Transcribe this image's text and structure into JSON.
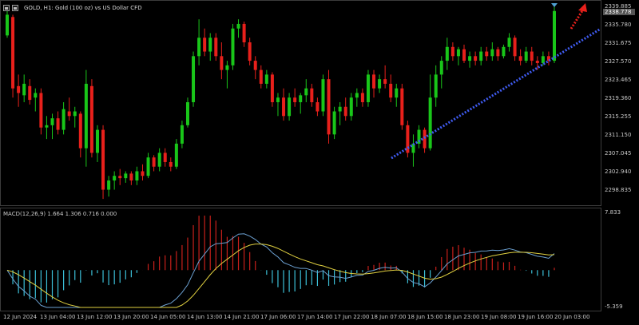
{
  "window": {
    "title": "GOLD, H1:  Gold (100 oz) vs US Dollar CFD"
  },
  "colors": {
    "background": "#000000",
    "bull_candle": "#19c619",
    "bear_candle": "#e8201b",
    "trendline": "#3f5bf0",
    "projection_arrow": "#e8201b",
    "macd_line": "#6b9fd0",
    "signal_line": "#e0d040",
    "hist_positive": "#c8201b",
    "hist_negative": "#3cc0d8",
    "marker": "#4fa0d0"
  },
  "price_axis": {
    "labels": [
      "2339.885",
      "2335.780",
      "2331.675",
      "2327.570",
      "2323.465",
      "2319.360",
      "2315.255",
      "2311.150",
      "2307.045",
      "2302.940",
      "2298.835"
    ],
    "current_price": "2338.778"
  },
  "macd": {
    "title": "MACD(12,26,9) 1.664 1.306 0.716 0.000",
    "axis_top": "7.833",
    "axis_bottom": "-5.359"
  },
  "time_axis": {
    "labels": [
      "12 Jun 2024",
      "13 Jun 04:00",
      "13 Jun 12:00",
      "13 Jun 20:00",
      "14 Jun 05:00",
      "14 Jun 13:00",
      "14 Jun 21:00",
      "17 Jun 06:00",
      "17 Jun 14:00",
      "17 Jun 22:00",
      "18 Jun 07:00",
      "18 Jun 15:00",
      "18 Jun 23:00",
      "19 Jun 08:00",
      "19 Jun 16:00",
      "20 Jun 03:00"
    ]
  },
  "chart_data": {
    "type": "candlestick",
    "symbol": "GOLD",
    "timeframe": "H1",
    "ylim": [
      2296.8,
      2340.5
    ],
    "candles": [
      [
        2333.5,
        2340.0,
        2333.0,
        2338.0
      ],
      [
        2337.5,
        2338.0,
        2320.0,
        2322.0
      ],
      [
        2322.5,
        2325.0,
        2318.0,
        2321.0
      ],
      [
        2320.5,
        2325.0,
        2319.0,
        2323.0
      ],
      [
        2322.5,
        2324.0,
        2318.5,
        2319.5
      ],
      [
        2320.0,
        2322.0,
        2317.0,
        2321.0
      ],
      [
        2321.0,
        2322.0,
        2312.0,
        2313.5
      ],
      [
        2313.5,
        2316.0,
        2311.0,
        2314.0
      ],
      [
        2314.0,
        2316.5,
        2311.0,
        2315.5
      ],
      [
        2315.5,
        2317.0,
        2312.0,
        2313.0
      ],
      [
        2313.0,
        2319.0,
        2312.0,
        2317.5
      ],
      [
        2317.0,
        2320.0,
        2315.0,
        2316.0
      ],
      [
        2316.0,
        2318.0,
        2313.5,
        2317.0
      ],
      [
        2316.5,
        2317.0,
        2307.0,
        2309.0
      ],
      [
        2309.0,
        2326.0,
        2305.0,
        2323.0
      ],
      [
        2322.5,
        2324.0,
        2307.0,
        2308.0
      ],
      [
        2308.0,
        2314.0,
        2306.0,
        2313.0
      ],
      [
        2313.0,
        2314.0,
        2298.0,
        2300.0
      ],
      [
        2300.0,
        2303.0,
        2298.5,
        2302.0
      ],
      [
        2302.0,
        2304.0,
        2300.0,
        2303.0
      ],
      [
        2303.0,
        2304.5,
        2301.0,
        2302.5
      ],
      [
        2302.5,
        2304.0,
        2301.5,
        2303.5
      ],
      [
        2303.5,
        2304.0,
        2301.0,
        2302.0
      ],
      [
        2302.0,
        2305.0,
        2301.0,
        2304.0
      ],
      [
        2304.0,
        2305.5,
        2302.0,
        2303.0
      ],
      [
        2303.0,
        2308.0,
        2302.5,
        2307.0
      ],
      [
        2307.0,
        2307.5,
        2304.0,
        2305.0
      ],
      [
        2305.0,
        2309.0,
        2304.0,
        2308.0
      ],
      [
        2308.0,
        2309.0,
        2305.0,
        2306.0
      ],
      [
        2306.0,
        2307.0,
        2304.0,
        2305.0
      ],
      [
        2305.0,
        2311.0,
        2304.5,
        2310.0
      ],
      [
        2310.0,
        2315.0,
        2309.0,
        2314.0
      ],
      [
        2314.0,
        2320.0,
        2313.5,
        2319.0
      ],
      [
        2319.0,
        2330.0,
        2318.0,
        2329.0
      ],
      [
        2329.0,
        2337.0,
        2327.0,
        2333.0
      ],
      [
        2333.0,
        2335.0,
        2329.0,
        2330.0
      ],
      [
        2330.0,
        2334.0,
        2328.0,
        2333.0
      ],
      [
        2333.0,
        2334.0,
        2328.0,
        2329.0
      ],
      [
        2329.0,
        2332.0,
        2324.0,
        2326.0
      ],
      [
        2326.0,
        2328.0,
        2322.0,
        2327.0
      ],
      [
        2327.0,
        2336.0,
        2326.0,
        2335.0
      ],
      [
        2335.0,
        2337.0,
        2333.0,
        2336.0
      ],
      [
        2336.0,
        2336.5,
        2331.0,
        2332.0
      ],
      [
        2332.0,
        2333.0,
        2327.0,
        2328.0
      ],
      [
        2328.0,
        2329.0,
        2324.0,
        2326.0
      ],
      [
        2326.0,
        2327.0,
        2322.0,
        2323.0
      ],
      [
        2323.0,
        2326.0,
        2322.0,
        2325.0
      ],
      [
        2325.0,
        2325.5,
        2318.0,
        2319.0
      ],
      [
        2319.0,
        2321.0,
        2316.0,
        2320.0
      ],
      [
        2320.0,
        2322.0,
        2315.0,
        2316.0
      ],
      [
        2316.0,
        2321.0,
        2315.0,
        2320.0
      ],
      [
        2320.0,
        2322.0,
        2318.0,
        2319.0
      ],
      [
        2319.0,
        2321.0,
        2316.5,
        2320.5
      ],
      [
        2320.5,
        2324.0,
        2319.0,
        2322.0
      ],
      [
        2322.0,
        2323.0,
        2318.0,
        2319.0
      ],
      [
        2319.0,
        2320.0,
        2316.0,
        2317.0
      ],
      [
        2317.0,
        2325.0,
        2316.0,
        2324.0
      ],
      [
        2324.0,
        2326.0,
        2310.0,
        2312.0
      ],
      [
        2312.0,
        2318.0,
        2311.0,
        2317.0
      ],
      [
        2317.0,
        2319.0,
        2314.0,
        2318.0
      ],
      [
        2318.0,
        2320.0,
        2315.0,
        2316.0
      ],
      [
        2316.0,
        2321.0,
        2315.0,
        2320.0
      ],
      [
        2320.0,
        2322.0,
        2318.0,
        2321.0
      ],
      [
        2321.0,
        2322.0,
        2318.0,
        2319.0
      ],
      [
        2319.0,
        2326.0,
        2318.0,
        2325.0
      ],
      [
        2325.0,
        2326.0,
        2320.0,
        2322.0
      ],
      [
        2322.0,
        2325.0,
        2321.0,
        2324.0
      ],
      [
        2324.0,
        2327.0,
        2322.0,
        2323.0
      ],
      [
        2323.0,
        2325.0,
        2319.0,
        2320.0
      ],
      [
        2320.0,
        2323.0,
        2318.0,
        2322.0
      ],
      [
        2322.0,
        2323.0,
        2313.0,
        2314.0
      ],
      [
        2314.0,
        2315.0,
        2307.0,
        2308.0
      ],
      [
        2308.0,
        2312.0,
        2305.0,
        2310.0
      ],
      [
        2310.0,
        2314.0,
        2309.0,
        2313.0
      ],
      [
        2313.0,
        2313.5,
        2308.0,
        2309.0
      ],
      [
        2309.0,
        2325.0,
        2308.5,
        2320.0
      ],
      [
        2320.0,
        2327.0,
        2318.0,
        2325.0
      ],
      [
        2325.0,
        2329.0,
        2322.0,
        2328.0
      ],
      [
        2328.0,
        2333.0,
        2326.0,
        2331.0
      ],
      [
        2331.0,
        2332.0,
        2328.0,
        2329.0
      ],
      [
        2329.0,
        2331.0,
        2327.0,
        2330.5
      ],
      [
        2330.5,
        2331.5,
        2327.5,
        2328.0
      ],
      [
        2328.0,
        2330.0,
        2326.5,
        2329.0
      ],
      [
        2329.0,
        2330.0,
        2327.0,
        2328.0
      ],
      [
        2328.0,
        2331.0,
        2327.0,
        2330.0
      ],
      [
        2330.0,
        2331.0,
        2328.0,
        2329.0
      ],
      [
        2329.0,
        2332.0,
        2328.0,
        2330.5
      ],
      [
        2330.5,
        2331.0,
        2328.0,
        2329.0
      ],
      [
        2329.0,
        2331.5,
        2328.5,
        2331.0
      ],
      [
        2331.0,
        2334.0,
        2330.0,
        2333.0
      ],
      [
        2333.0,
        2333.5,
        2328.0,
        2329.0
      ],
      [
        2329.0,
        2330.5,
        2327.0,
        2328.0
      ],
      [
        2328.0,
        2331.0,
        2327.5,
        2330.0
      ],
      [
        2330.0,
        2331.0,
        2327.0,
        2328.0
      ],
      [
        2328.0,
        2329.0,
        2326.0,
        2327.5
      ],
      [
        2327.5,
        2330.0,
        2327.0,
        2329.0
      ],
      [
        2329.0,
        2330.0,
        2327.0,
        2328.0
      ],
      [
        2328.0,
        2339.9,
        2327.5,
        2338.8
      ]
    ]
  }
}
